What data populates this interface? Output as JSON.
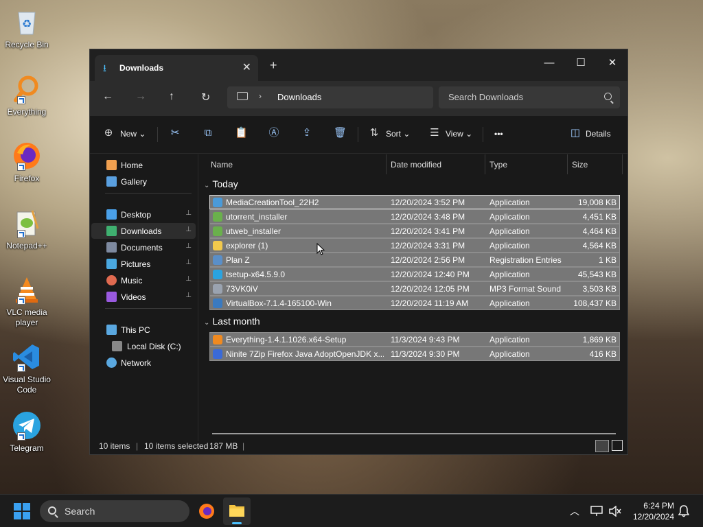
{
  "desktop": {
    "icons": [
      {
        "label": "Recycle Bin",
        "icon": "recycle-bin-icon"
      },
      {
        "label": "Everything",
        "icon": "everything-search-icon"
      },
      {
        "label": "Firefox",
        "icon": "firefox-icon"
      },
      {
        "label": "Notepad++",
        "icon": "notepad-plus-plus-icon"
      },
      {
        "label": "VLC media player",
        "icon": "vlc-icon"
      },
      {
        "label": "Visual Studio Code",
        "icon": "vscode-icon"
      },
      {
        "label": "Telegram",
        "icon": "telegram-icon"
      }
    ]
  },
  "window": {
    "tab_label": "Downloads",
    "new_tab": "+",
    "close": "✕",
    "minimize": "—",
    "maximize": "☐",
    "close_window": "✕"
  },
  "nav": {
    "breadcrumb": "Downloads",
    "search_placeholder": "Search Downloads"
  },
  "toolbar": {
    "new_label": "New",
    "sort_label": "Sort",
    "view_label": "View",
    "more_label": "•••",
    "details_label": "Details"
  },
  "sidebar": {
    "items": [
      {
        "label": "Home",
        "color": "#f0a050"
      },
      {
        "label": "Gallery",
        "color": "#5aa0e0"
      },
      {
        "label": "Desktop",
        "color": "#4aa0e8",
        "pinned": true
      },
      {
        "label": "Downloads",
        "color": "#3fb070",
        "pinned": true
      },
      {
        "label": "Documents",
        "color": "#7e8aa0",
        "pinned": true
      },
      {
        "label": "Pictures",
        "color": "#4aa8e0",
        "pinned": true
      },
      {
        "label": "Music",
        "color": "#e06a50",
        "pinned": true
      },
      {
        "label": "Videos",
        "color": "#9a5ae0",
        "pinned": true
      },
      {
        "label": "This PC",
        "color": "#5aa8e0"
      },
      {
        "label": "Local Disk (C:)",
        "color": "#888"
      },
      {
        "label": "Network",
        "color": "#5aa8e0"
      }
    ],
    "pin_glyph": "📌"
  },
  "columns": {
    "name": "Name",
    "date": "Date modified",
    "type": "Type",
    "size": "Size"
  },
  "groups": {
    "today": "Today",
    "last_month": "Last month"
  },
  "files_today": [
    {
      "name": "MediaCreationTool_22H2",
      "date": "12/20/2024 3:52 PM",
      "type": "Application",
      "size": "19,008 KB",
      "icon_color": "#4a9ad8"
    },
    {
      "name": "utorrent_installer",
      "date": "12/20/2024 3:48 PM",
      "type": "Application",
      "size": "4,451 KB",
      "icon_color": "#6ab04c"
    },
    {
      "name": "utweb_installer",
      "date": "12/20/2024 3:41 PM",
      "type": "Application",
      "size": "4,464 KB",
      "icon_color": "#6ab04c"
    },
    {
      "name": "explorer (1)",
      "date": "12/20/2024 3:31 PM",
      "type": "Application",
      "size": "4,564 KB",
      "icon_color": "#f2c94c"
    },
    {
      "name": "Plan Z",
      "date": "12/20/2024 2:56 PM",
      "type": "Registration Entries",
      "size": "1 KB",
      "icon_color": "#5a8fc8"
    },
    {
      "name": "tsetup-x64.5.9.0",
      "date": "12/20/2024 12:40 PM",
      "type": "Application",
      "size": "45,543 KB",
      "icon_color": "#2aa3e0"
    },
    {
      "name": "73VK0iV",
      "date": "12/20/2024 12:05 PM",
      "type": "MP3 Format Sound",
      "size": "3,503 KB",
      "icon_color": "#9aa3b0"
    },
    {
      "name": "VirtualBox-7.1.4-165100-Win",
      "date": "12/20/2024 11:19 AM",
      "type": "Application",
      "size": "108,437 KB",
      "icon_color": "#3a7ac0"
    }
  ],
  "files_last_month": [
    {
      "name": "Everything-1.4.1.1026.x64-Setup",
      "date": "11/3/2024 9:43 PM",
      "type": "Application",
      "size": "1,869 KB",
      "icon_color": "#f08a20"
    },
    {
      "name": "Ninite 7Zip Firefox Java AdoptOpenJDK x...",
      "date": "11/3/2024 9:30 PM",
      "type": "Application",
      "size": "416 KB",
      "icon_color": "#3a6ad8"
    }
  ],
  "status": {
    "items": "10 items",
    "selected": "10 items selected",
    "size": "187 MB"
  },
  "taskbar": {
    "search_label": "Search",
    "time": "6:24 PM",
    "date": "12/20/2024"
  }
}
